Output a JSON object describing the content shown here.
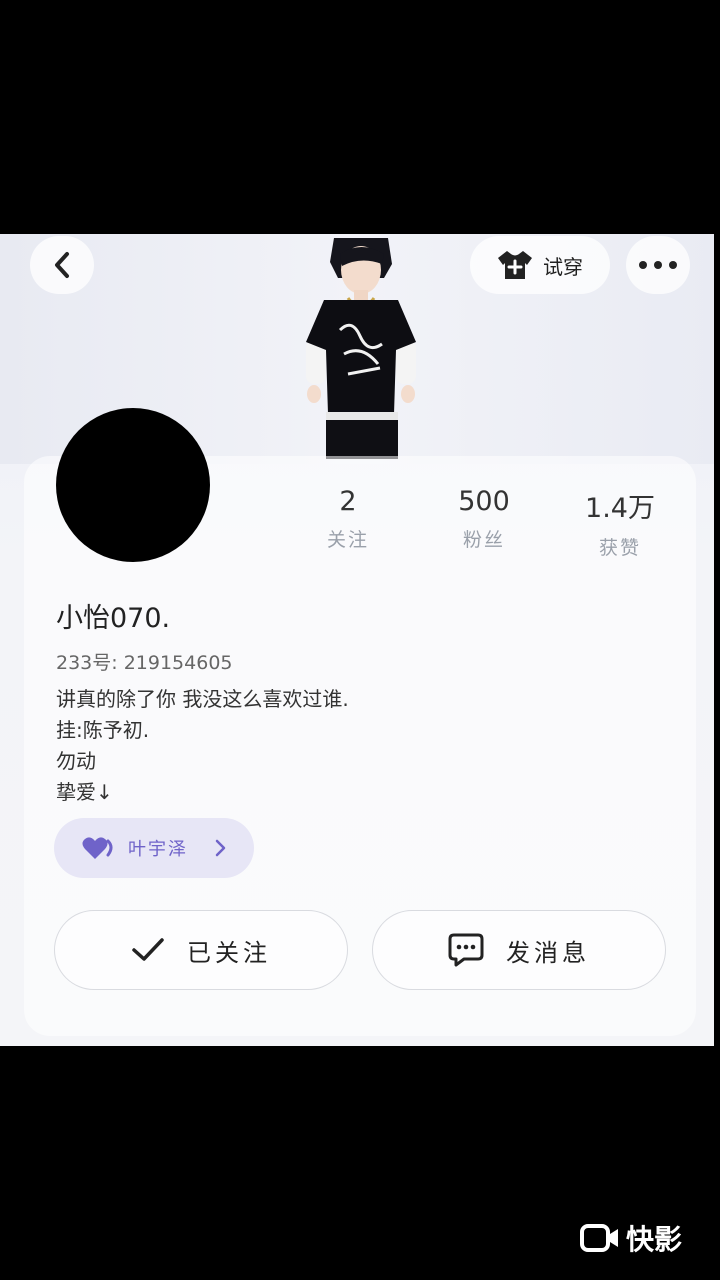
{
  "header": {
    "try_on_label": "试穿"
  },
  "profile": {
    "stats": [
      {
        "value": "2",
        "label": "关注"
      },
      {
        "value": "500",
        "label": "粉丝"
      },
      {
        "value": "1.4万",
        "label": "获赞"
      }
    ],
    "nickname": "小怡070.",
    "uid": "233号: 219154605",
    "bio": [
      "讲真的除了你 我没这么喜欢过谁.",
      "挂:陈予初.",
      "勿动",
      "挚爱↓"
    ],
    "cp_name": "叶宇泽"
  },
  "actions": {
    "follow_label": "已关注",
    "message_label": "发消息"
  },
  "watermark": {
    "text": "快影"
  }
}
